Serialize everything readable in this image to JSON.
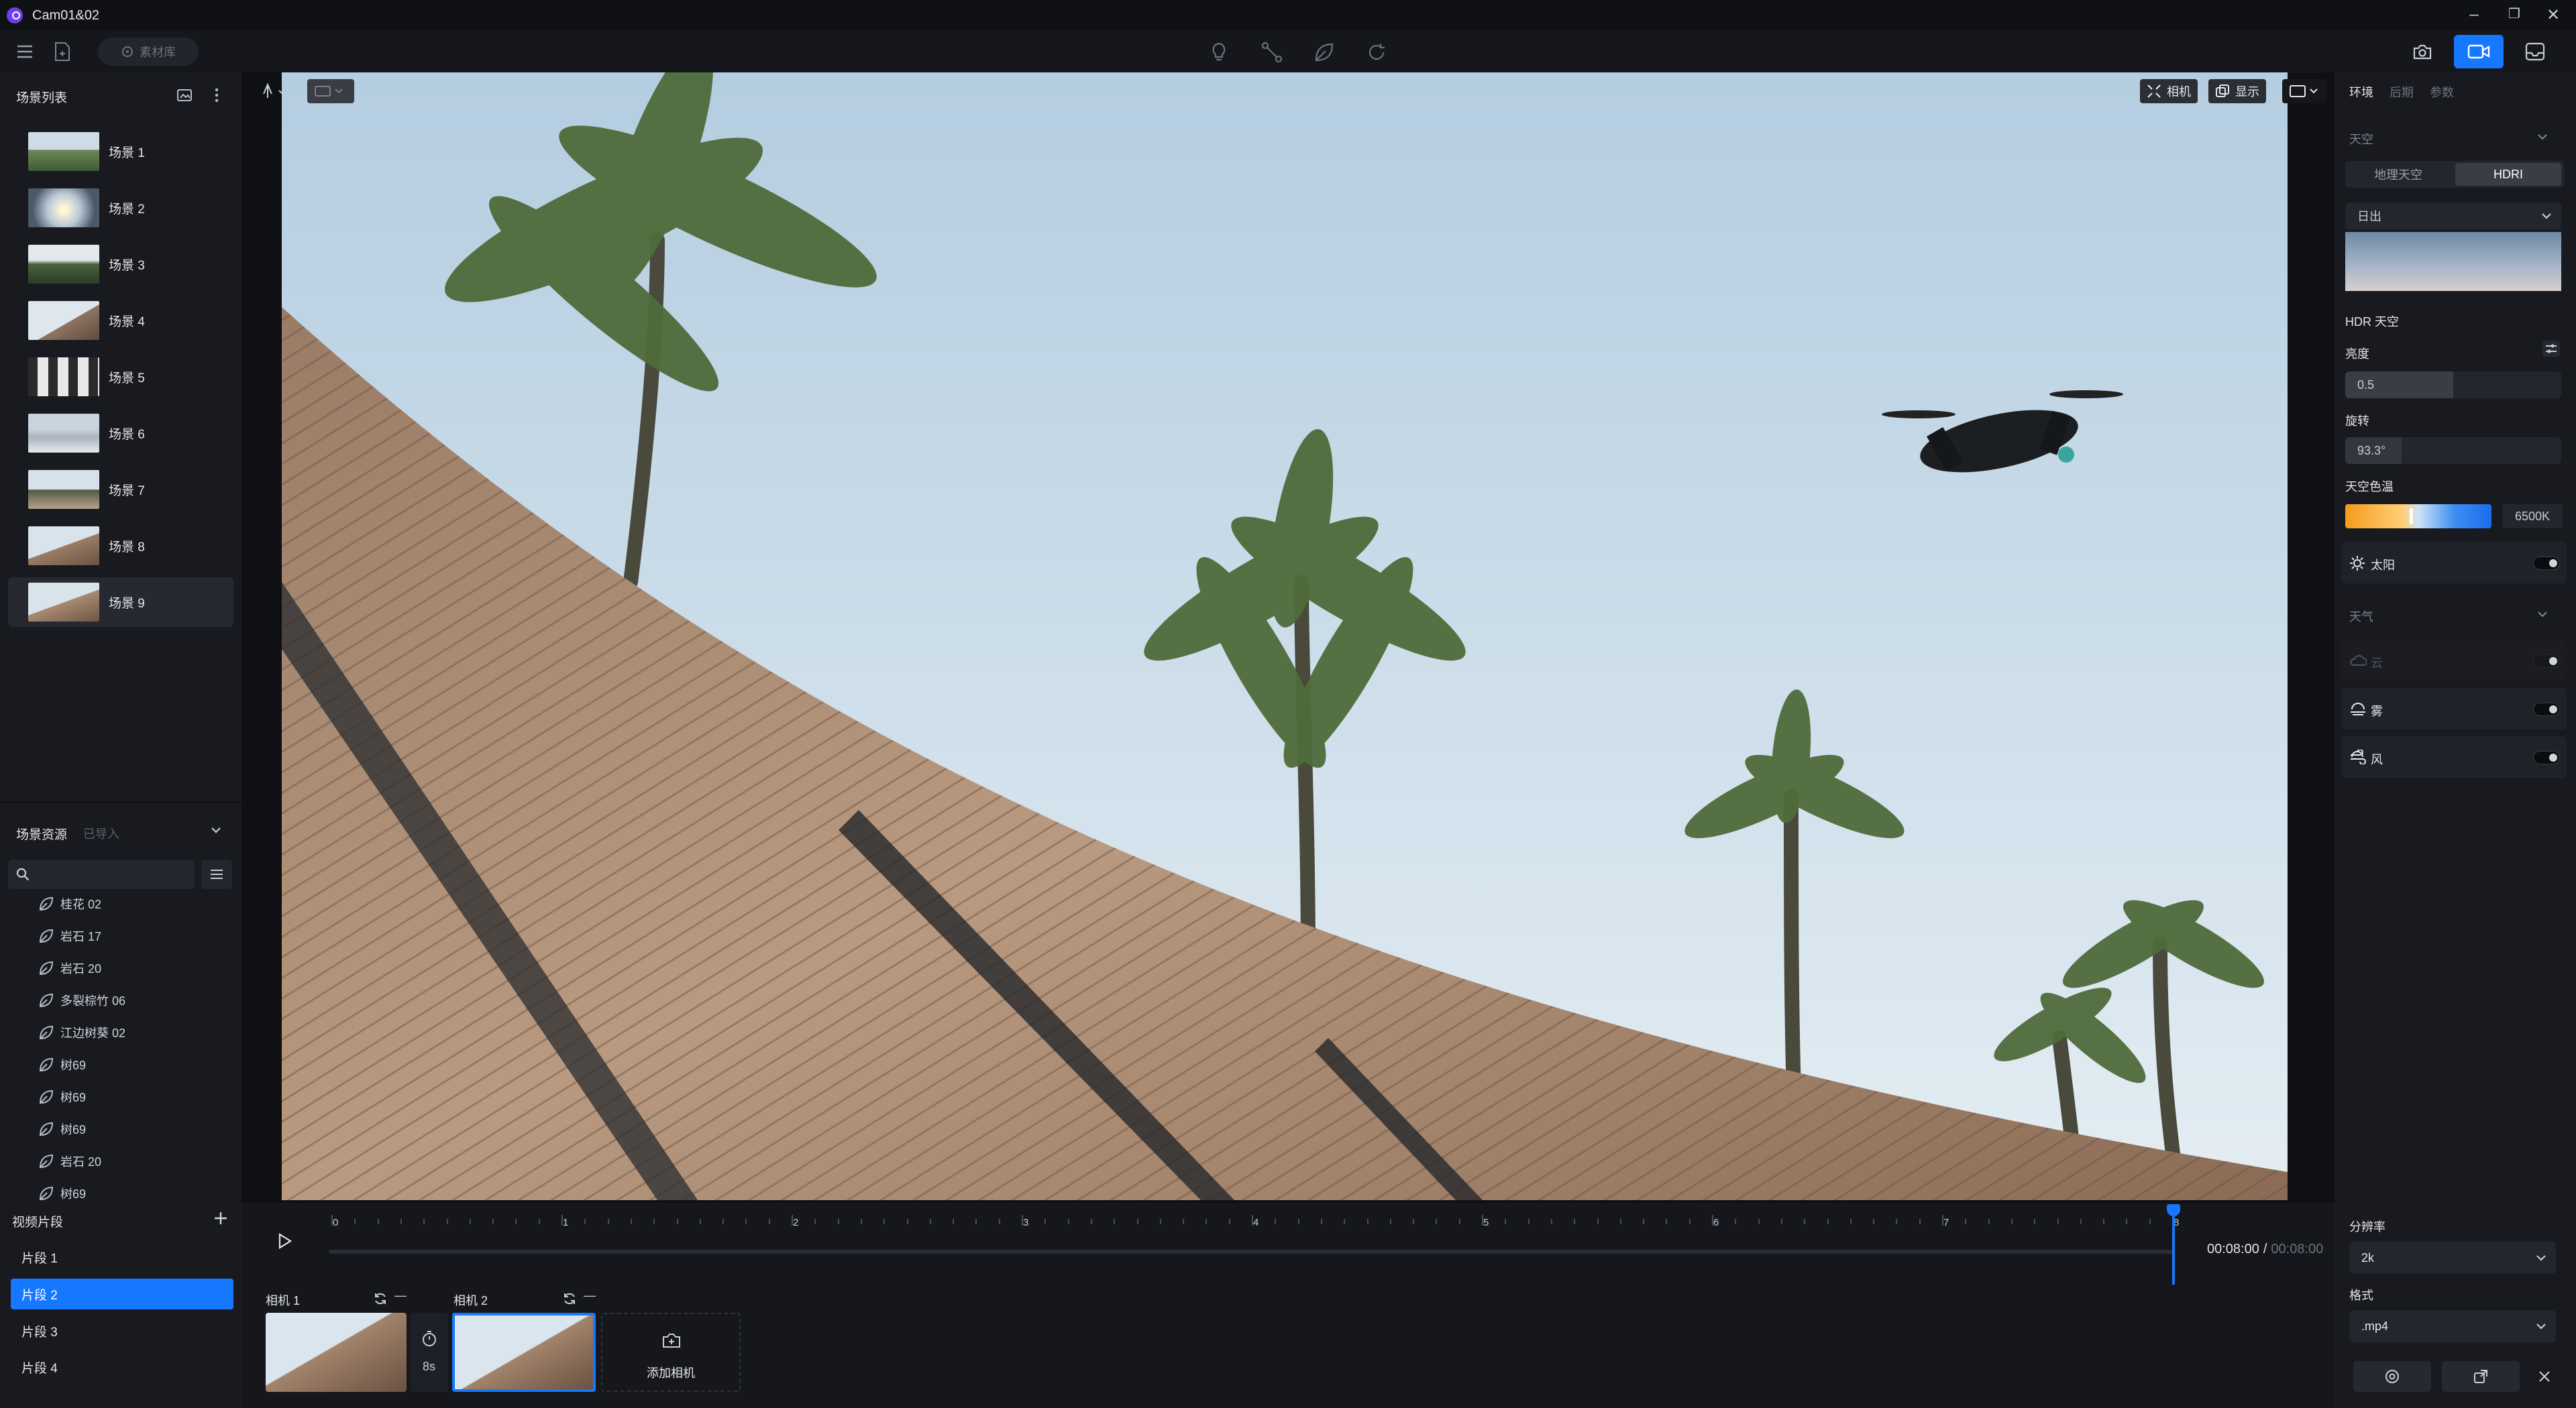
{
  "app": {
    "title": "Cam01&02"
  },
  "toolbar": {
    "material_library": "素材库"
  },
  "scene_list": {
    "header": "场景列表",
    "items": [
      {
        "label": "场景 1"
      },
      {
        "label": "场景 2"
      },
      {
        "label": "场景 3"
      },
      {
        "label": "场景 4"
      },
      {
        "label": "场景 5"
      },
      {
        "label": "场景 6"
      },
      {
        "label": "场景 7"
      },
      {
        "label": "场景 8"
      },
      {
        "label": "场景 9"
      }
    ],
    "selected_index": 8
  },
  "scene_assets": {
    "header": "场景资源",
    "tab_imported": "已导入",
    "search_placeholder": "",
    "items": [
      {
        "label": "桂花 02"
      },
      {
        "label": "岩石 17"
      },
      {
        "label": "岩石 20"
      },
      {
        "label": "多裂棕竹 06"
      },
      {
        "label": "江边树葵 02"
      },
      {
        "label": "树69"
      },
      {
        "label": "树69"
      },
      {
        "label": "树69"
      },
      {
        "label": "岩石 20"
      },
      {
        "label": "树69"
      }
    ]
  },
  "viewport": {
    "camera_button": "相机",
    "display_button": "显示"
  },
  "right_panel": {
    "tabs": [
      "环境",
      "后期",
      "参数"
    ],
    "active_tab": "环境",
    "sky_header": "天空",
    "sky_tabs": [
      "地理天空",
      "HDRI"
    ],
    "sky_active": "HDRI",
    "preset": "日出",
    "hdr_sky_label": "HDR 天空",
    "brightness_label": "亮度",
    "brightness_value": "0.5",
    "brightness_fraction": 0.5,
    "rotation_label": "旋转",
    "rotation_value": "93.3°",
    "color_temp_label": "天空色温",
    "color_temp_value": "6500K",
    "sun_label": "太阳",
    "weather_header": "天气",
    "cloud_label": "云",
    "fog_label": "雾",
    "wind_label": "风"
  },
  "video_clips": {
    "header": "视频片段",
    "items": [
      {
        "label": "片段 1"
      },
      {
        "label": "片段 2"
      },
      {
        "label": "片段 3"
      },
      {
        "label": "片段 4"
      }
    ],
    "selected_index": 1
  },
  "timeline": {
    "ticks": [
      "0",
      "1",
      "2",
      "3",
      "4",
      "5",
      "6",
      "7",
      "8"
    ],
    "current_time": "00:08:00",
    "separator": "/",
    "total_time": "00:08:00",
    "playhead_seconds": 8
  },
  "cameras": {
    "camera1_label": "相机 1",
    "camera2_label": "相机 2",
    "dash": "—",
    "duration": "8s",
    "add_camera": "添加相机"
  },
  "export": {
    "resolution_label": "分辨率",
    "resolution_value": "2k",
    "format_label": "格式",
    "format_value": ".mp4"
  },
  "colors": {
    "accent": "#1677ff",
    "panel": "#181a20",
    "bg": "#14161b"
  }
}
